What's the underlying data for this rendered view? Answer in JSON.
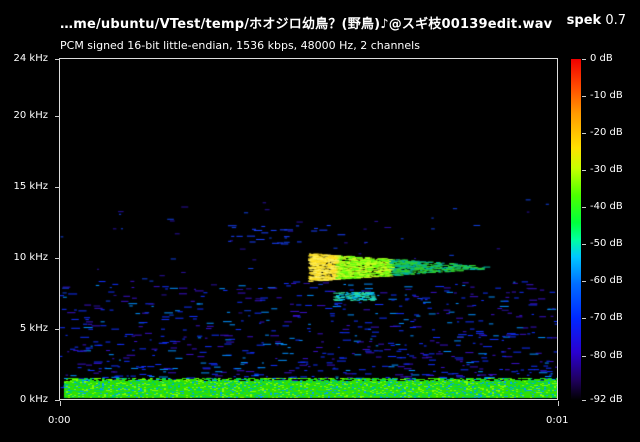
{
  "header": {
    "file_title": "…me/ubuntu/VTest/temp/ホオジロ幼鳥？(野鳥)♪@スギ枝00139edit.wav",
    "app_name": "spek",
    "app_version": "0.7",
    "stream_info": "PCM signed 16-bit little-endian, 1536 kbps, 48000 Hz, 2 channels"
  },
  "frequency_axis": {
    "ticks": [
      "24 kHz",
      "20 kHz",
      "15 kHz",
      "10 kHz",
      "5 kHz",
      "0 kHz"
    ],
    "values_khz": [
      24,
      20,
      15,
      10,
      5,
      0
    ]
  },
  "time_axis": {
    "ticks": [
      "0:00",
      "0:01"
    ],
    "values_s": [
      0,
      1
    ]
  },
  "colorbar": {
    "labels": [
      "0 dB",
      "-10 dB",
      "-20 dB",
      "-30 dB",
      "-40 dB",
      "-50 dB",
      "-60 dB",
      "-70 dB",
      "-80 dB",
      "-92 dB"
    ],
    "values_db": [
      0,
      -10,
      -20,
      -30,
      -40,
      -50,
      -60,
      -70,
      -80,
      -92
    ]
  },
  "colors": {
    "background": "#000000",
    "low_band": "#40ff20",
    "call_core": "#ffff40",
    "noise": "#2040ff"
  }
}
